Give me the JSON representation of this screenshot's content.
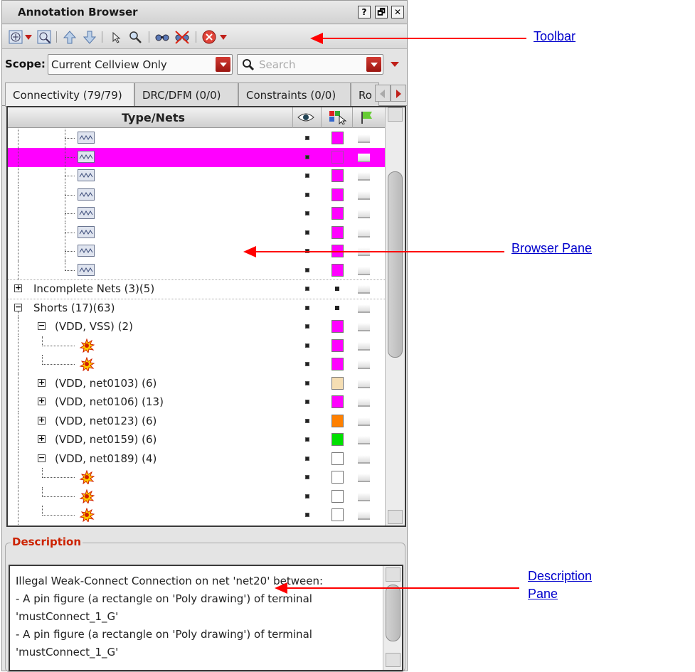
{
  "window": {
    "title": "Annotation Browser",
    "buttons": [
      "?",
      "🗗",
      "✕"
    ]
  },
  "toolbar": {
    "icons": [
      "zoom-fit-icon",
      "zoom-area-icon",
      "arrow-up-icon",
      "arrow-down-icon",
      "pointer-icon",
      "magnifier-icon",
      "binoculars-icon",
      "binoculars-off-icon",
      "stop-icon"
    ]
  },
  "scope": {
    "label": "Scope:",
    "value": "Current Cellview Only",
    "search_placeholder": "Search"
  },
  "tabs": [
    "Connectivity (79/79)",
    "DRC/DFM (0/0)",
    "Constraints (0/0)",
    "Ro"
  ],
  "tree": {
    "header": "Type/Nets",
    "column_icons": [
      "eye-icon",
      "select-color-icon",
      "flag-icon"
    ],
    "rows": [
      {
        "kind": "wave",
        "swatch": "#ff00ff"
      },
      {
        "kind": "wave",
        "swatch": "#ff00ff",
        "selected": true
      },
      {
        "kind": "wave",
        "swatch": "#ff00ff"
      },
      {
        "kind": "wave",
        "swatch": "#ff00ff"
      },
      {
        "kind": "wave",
        "swatch": "#ff00ff"
      },
      {
        "kind": "wave",
        "swatch": "#ff00ff"
      },
      {
        "kind": "wave",
        "swatch": "#ff00ff"
      },
      {
        "kind": "wave",
        "swatch": "#ff00ff"
      },
      {
        "kind": "group",
        "label": "Incomplete Nets (3)(5)",
        "expander": "+"
      },
      {
        "kind": "group",
        "label": "Shorts (17)(63)",
        "expander": "-"
      },
      {
        "kind": "sub",
        "label": "(VDD, VSS) (2)",
        "expander": "-",
        "swatch": "#ff00ff"
      },
      {
        "kind": "burst",
        "swatch": "#ff00ff"
      },
      {
        "kind": "burst",
        "swatch": "#ff00ff"
      },
      {
        "kind": "sub",
        "label": "(VDD, net0103) (6)",
        "expander": "+",
        "swatch": "#f5deb3"
      },
      {
        "kind": "sub",
        "label": "(VDD, net0106) (13)",
        "expander": "+",
        "swatch": "#ff00ff"
      },
      {
        "kind": "sub",
        "label": "(VDD, net0123) (6)",
        "expander": "+",
        "swatch": "#ff8000"
      },
      {
        "kind": "sub",
        "label": "(VDD, net0159) (6)",
        "expander": "+",
        "swatch": "#00e000"
      },
      {
        "kind": "sub",
        "label": "(VDD, net0189) (4)",
        "expander": "-",
        "swatch": "#ffffff"
      },
      {
        "kind": "burst",
        "swatch": "#ffffff"
      },
      {
        "kind": "burst",
        "swatch": "#ffffff"
      },
      {
        "kind": "burst",
        "swatch": "#ffffff"
      }
    ]
  },
  "description": {
    "title": "Description",
    "lines": [
      "Illegal Weak-Connect Connection on net 'net20' between:",
      "- A pin figure (a rectangle on 'Poly drawing') of terminal",
      "'mustConnect_1_G'",
      "- A pin figure (a rectangle on 'Poly drawing') of terminal",
      "'mustConnect_1_G'"
    ]
  },
  "callouts": {
    "toolbar": "Toolbar",
    "browser": "Browser Pane",
    "desc1": "Description",
    "desc2": "Pane"
  },
  "colors": {
    "accent_red": "#ff0000",
    "link_blue": "#0000cc",
    "highlight": "#ff00ff"
  }
}
